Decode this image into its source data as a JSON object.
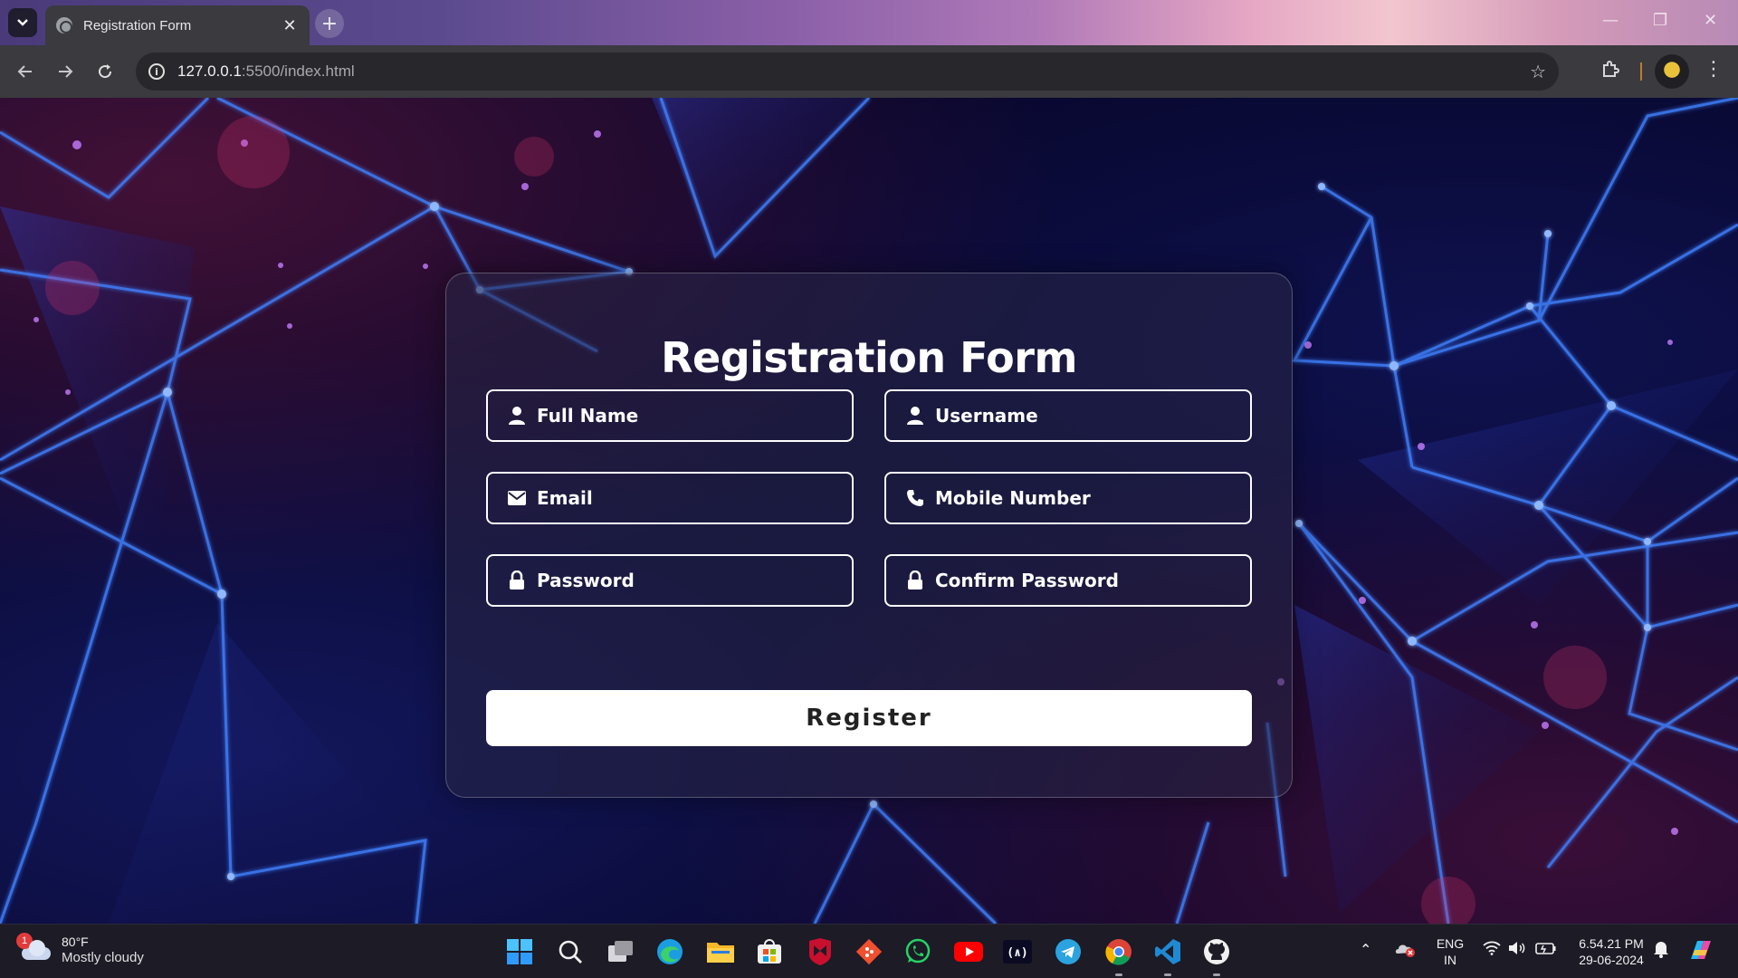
{
  "browser": {
    "tab_title": "Registration Form",
    "tab_close": "✕",
    "new_tab": "+",
    "url_host": "127.0.0.1",
    "url_rest": ":5500/index.html"
  },
  "form": {
    "title": "Registration Form",
    "fields": [
      {
        "placeholder": "Full Name",
        "icon": "user-icon"
      },
      {
        "placeholder": "Username",
        "icon": "user-icon"
      },
      {
        "placeholder": "Email",
        "icon": "envelope-icon"
      },
      {
        "placeholder": "Mobile Number",
        "icon": "phone-icon"
      },
      {
        "placeholder": "Password",
        "icon": "lock-icon"
      },
      {
        "placeholder": "Confirm Password",
        "icon": "lock-icon"
      }
    ],
    "submit_label": "Register"
  },
  "taskbar": {
    "weather_badge": "1",
    "weather_temp": "80°F",
    "weather_condition": "Mostly cloudy",
    "language_line1": "ENG",
    "language_line2": "IN",
    "time": "6.54.21 PM",
    "date": "29-06-2024",
    "pinned_apps": [
      "start",
      "search",
      "task-view",
      "edge",
      "file-explorer",
      "store",
      "mcafee",
      "git",
      "whatsapp",
      "youtube",
      "freecodecamp",
      "telegram",
      "chrome",
      "vscode",
      "github"
    ]
  },
  "colors": {
    "page_bg": "#07062a",
    "network_lines": "#3a7bff",
    "card_border": "#ffffff",
    "button_bg": "#ffffff",
    "chrome_bg": "#3a3a3f",
    "taskbar_bg": "#1c1b26"
  }
}
